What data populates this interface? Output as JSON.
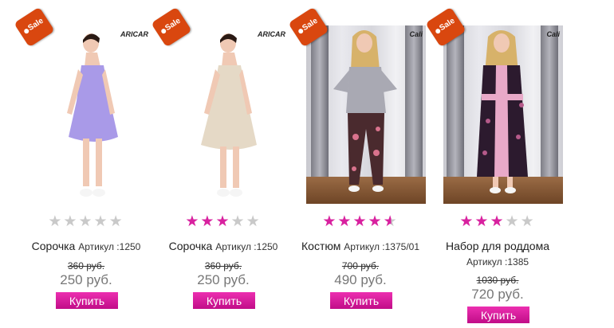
{
  "products": [
    {
      "sale_label": "Sale",
      "brand": "ARICAR",
      "name": "Сорочка",
      "sku": "Артикул :1250",
      "old_price": "360 руб.",
      "price": "250 руб.",
      "buy_label": "Купить",
      "rating": 0
    },
    {
      "sale_label": "Sale",
      "brand": "ARICAR",
      "name": "Сорочка",
      "sku": "Артикул :1250",
      "old_price": "360 руб.",
      "price": "250 руб.",
      "buy_label": "Купить",
      "rating": 3
    },
    {
      "sale_label": "Sale",
      "brand": "Cali",
      "name": "Костюм",
      "sku": "Артикул :1375/01",
      "old_price": "700 руб.",
      "price": "490 руб.",
      "buy_label": "Купить",
      "rating": 4.5
    },
    {
      "sale_label": "Sale",
      "brand": "Cali",
      "name": "Набор для роддома",
      "sku": "Артикул :1385",
      "old_price": "1030 руб.",
      "price": "720 руб.",
      "buy_label": "Купить",
      "rating": 3
    }
  ],
  "colors": {
    "accent": "#d8219f",
    "sale_tag": "#d9470f",
    "star_off": "#c9c9c9"
  },
  "icons": {
    "sale": "sale-tag-icon",
    "star": "star-icon"
  }
}
